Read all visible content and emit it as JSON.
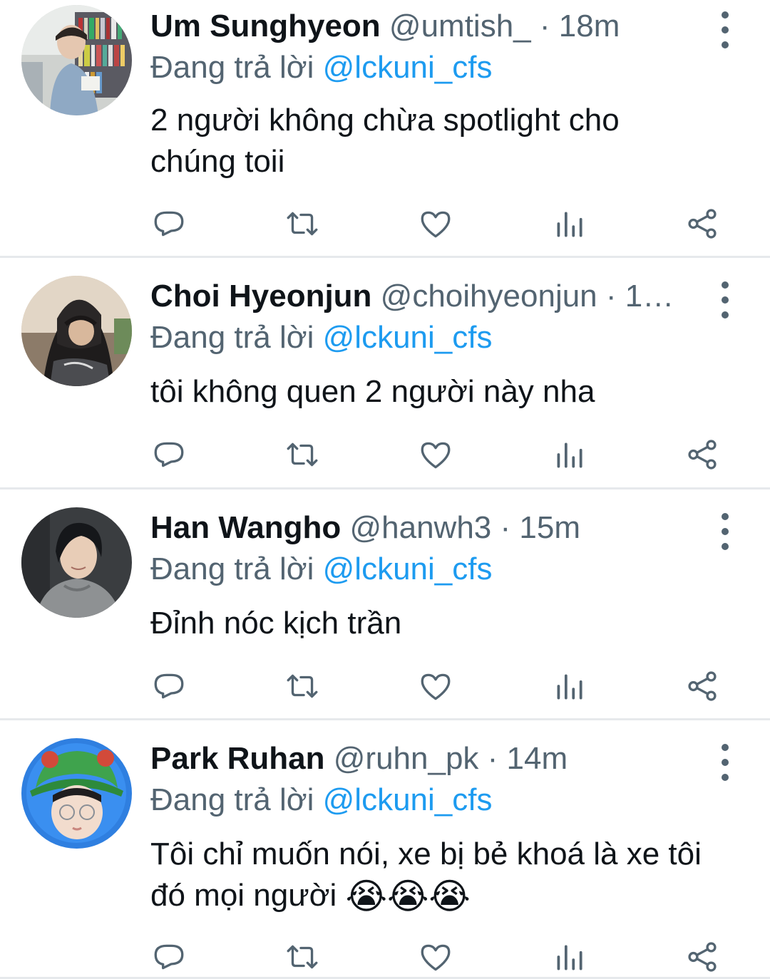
{
  "tweets": [
    {
      "name": "Um Sunghyeon",
      "handle": "@umtish_",
      "separator": "·",
      "time": "18m",
      "reply_prefix": "Đang trả lời",
      "reply_to": "@lckuni_cfs",
      "text": "2 người không chừa spotlight cho chúng toii"
    },
    {
      "name": "Choi Hyeonjun",
      "handle": "@choihyeonjun",
      "separator": "·",
      "time": "1…",
      "reply_prefix": "Đang trả lời",
      "reply_to": "@lckuni_cfs",
      "text": "tôi không quen 2 người này nha"
    },
    {
      "name": "Han Wangho",
      "handle": "@hanwh3",
      "separator": "·",
      "time": "15m",
      "reply_prefix": "Đang trả lời",
      "reply_to": "@lckuni_cfs",
      "text": "Đỉnh nóc kịch trần"
    },
    {
      "name": "Park Ruhan",
      "handle": "@ruhn_pk",
      "separator": "·",
      "time": "14m",
      "reply_prefix": "Đang trả lời",
      "reply_to": "@lckuni_cfs",
      "text": "Tôi chỉ muốn nói, xe bị bẻ khoá là xe tôi đó mọi người",
      "emoji": "😭😭😭"
    }
  ],
  "icons": {
    "reply": "reply-icon",
    "retweet": "retweet-icon",
    "like": "heart-icon",
    "views": "views-icon",
    "share": "share-icon",
    "more": "more-vertical-icon"
  },
  "colors": {
    "name": "#0f1419",
    "secondary": "#536471",
    "mention": "#1d9bf0",
    "divider": "#e6e9ec"
  }
}
